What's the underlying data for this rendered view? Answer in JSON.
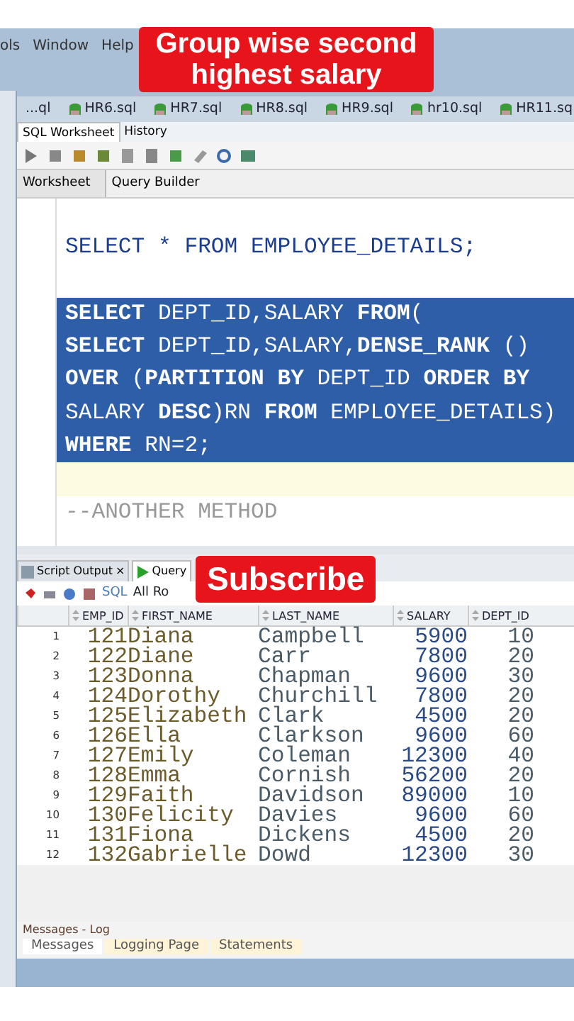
{
  "menu": [
    {
      "label": "ols"
    },
    {
      "label": "Window"
    },
    {
      "label": "Help"
    }
  ],
  "title_caption": "Group wise second highest salary",
  "file_tabs": [
    {
      "label": "...ql",
      "icon": false
    },
    {
      "label": "HR6.sql",
      "icon": true
    },
    {
      "label": "HR7.sql",
      "icon": true
    },
    {
      "label": "HR8.sql",
      "icon": true
    },
    {
      "label": "HR9.sql",
      "icon": true
    },
    {
      "label": "hr10.sql",
      "icon": true
    },
    {
      "label": "HR11.sq",
      "icon": true
    }
  ],
  "worksheet_tabs": [
    {
      "label": "SQL Worksheet",
      "selected": true
    },
    {
      "label": "History",
      "selected": false
    }
  ],
  "editor_tabs": [
    {
      "label": "Worksheet",
      "selected": true
    },
    {
      "label": "Query Builder",
      "selected": false
    }
  ],
  "code_lines": [
    {
      "kind": "blank"
    },
    {
      "kind": "code",
      "selected": false,
      "text": "SELECT * FROM EMPLOYEE_DETAILS;"
    },
    {
      "kind": "blank"
    },
    {
      "kind": "code",
      "selected": true,
      "text": "**SELECT** DEPT_ID,SALARY **FROM**("
    },
    {
      "kind": "code",
      "selected": true,
      "text": "**SELECT** DEPT_ID,SALARY,**DENSE_RANK** ()"
    },
    {
      "kind": "code",
      "selected": true,
      "text": "**OVER** (**PARTITION BY** DEPT_ID **ORDER BY**"
    },
    {
      "kind": "code",
      "selected": true,
      "text": "SALARY **DESC**)RN **FROM** EMPLOYEE_DETAILS)"
    },
    {
      "kind": "code",
      "selected": true,
      "text": "**WHERE** RN=2;"
    },
    {
      "kind": "current"
    },
    {
      "kind": "comment",
      "selected": false,
      "text": "--ANOTHER METHOD"
    }
  ],
  "output_tabs": [
    {
      "label": "Script Output",
      "selected": false,
      "close": "×"
    },
    {
      "label": "Query",
      "selected": true
    }
  ],
  "output_toolbar": {
    "sql_label": "SQL",
    "rows_label": "All Ro"
  },
  "subscribe_caption": "Subscribe",
  "table": {
    "columns": [
      "EMP_ID",
      "FIRST_NAME",
      "LAST_NAME",
      "SALARY",
      "DEPT_ID"
    ],
    "rows": [
      {
        "index": "1",
        "cells": [
          "121",
          "Diana",
          "Campbell",
          "5900",
          "10"
        ]
      },
      {
        "index": "2",
        "cells": [
          "122",
          "Diane",
          "Carr",
          "7800",
          "20"
        ]
      },
      {
        "index": "3",
        "cells": [
          "123",
          "Donna",
          "Chapman",
          "9600",
          "30"
        ]
      },
      {
        "index": "4",
        "cells": [
          "124",
          "Dorothy",
          "Churchill",
          "7800",
          "20"
        ]
      },
      {
        "index": "5",
        "cells": [
          "125",
          "Elizabeth",
          "Clark",
          "4500",
          "20"
        ]
      },
      {
        "index": "6",
        "cells": [
          "126",
          "Ella",
          "Clarkson",
          "9600",
          "60"
        ]
      },
      {
        "index": "7",
        "cells": [
          "127",
          "Emily",
          "Coleman",
          "12300",
          "40"
        ]
      },
      {
        "index": "8",
        "cells": [
          "128",
          "Emma",
          "Cornish",
          "56200",
          "20"
        ]
      },
      {
        "index": "9",
        "cells": [
          "129",
          "Faith",
          "Davidson",
          "89000",
          "10"
        ]
      },
      {
        "index": "10",
        "cells": [
          "130",
          "Felicity",
          "Davies",
          "9600",
          "60"
        ]
      },
      {
        "index": "11",
        "cells": [
          "131",
          "Fiona",
          "Dickens",
          "4500",
          "20"
        ]
      },
      {
        "index": "12",
        "cells": [
          "132",
          "Gabrielle",
          "Dowd",
          "12300",
          "30"
        ]
      }
    ]
  },
  "log": {
    "title": "Messages - Log",
    "tabs": [
      {
        "label": "Messages",
        "selected": true
      },
      {
        "label": "Logging Page",
        "selected": false
      },
      {
        "label": "Statements",
        "selected": false
      }
    ]
  }
}
